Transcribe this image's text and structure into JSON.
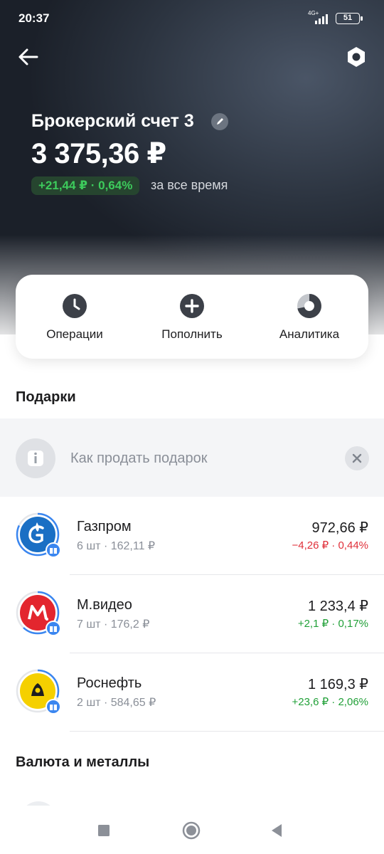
{
  "status_bar": {
    "time": "20:37",
    "network": "4G+",
    "battery": "51"
  },
  "header": {
    "account_name": "Брокерский счет 3",
    "balance": "3 375,36 ₽",
    "profit": "+21,44 ₽ · 0,64%",
    "profit_period": "за все время"
  },
  "actions": [
    {
      "label": "Операции",
      "icon": "clock-icon"
    },
    {
      "label": "Пополнить",
      "icon": "plus-circle-icon"
    },
    {
      "label": "Аналитика",
      "icon": "donut-chart-icon"
    }
  ],
  "gifts_section": {
    "title": "Подарки",
    "hint": "Как продать подарок"
  },
  "assets": [
    {
      "name": "Газпром",
      "qty": "6 шт · 162,11 ₽",
      "price": "972,66 ₽",
      "change": "−4,26 ₽ · 0,44%",
      "trend": "negative",
      "brand_color": "#1a6fc4",
      "progress": 0.82
    },
    {
      "name": "М.видео",
      "qty": "7 шт · 176,2 ₽",
      "price": "1 233,4 ₽",
      "change": "+2,1 ₽ · 0,17%",
      "trend": "positive",
      "brand_color": "#e3262e",
      "progress": 0.62
    },
    {
      "name": "Роснефть",
      "qty": "2 шт · 584,65 ₽",
      "price": "1 169,3 ₽",
      "change": "+23,6 ₽ · 2,06%",
      "trend": "positive",
      "brand_color": "#f5d000",
      "progress": 0.3
    }
  ],
  "currency_section": {
    "title": "Валюта и металлы"
  },
  "colors": {
    "accent_blue": "#3a86f0",
    "positive": "#21a038",
    "negative": "#e0303a",
    "hero_dark": "#1d222b"
  }
}
